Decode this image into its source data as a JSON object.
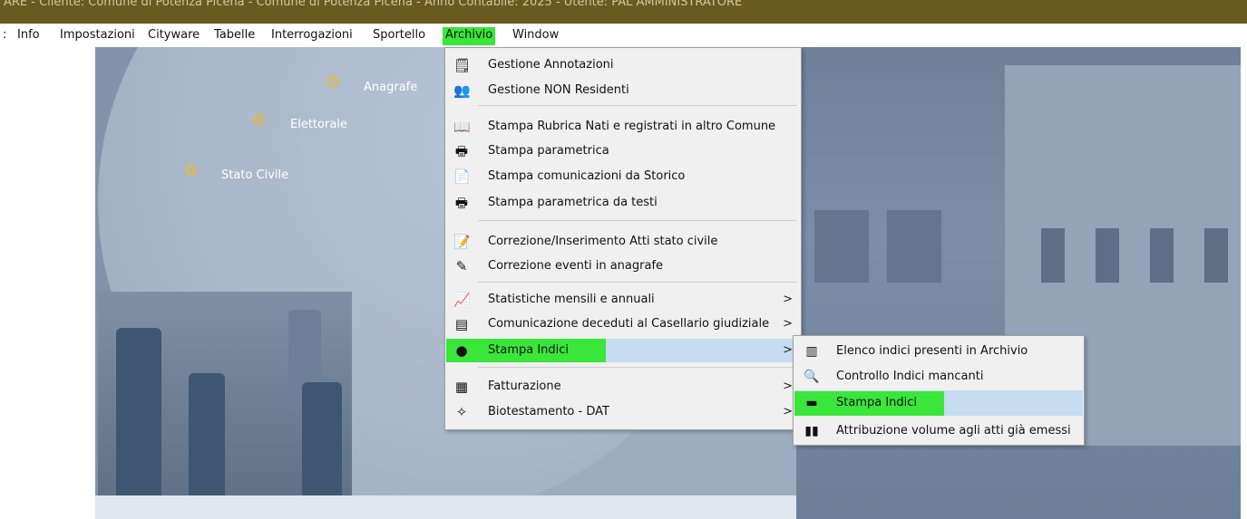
{
  "title_bar": {
    "text": "ARE - Cliente: Comune di Potenza Picena - Comune di Potenza Picena - Anno Contabile: 2025 - Utente: PAL AMMINISTRATORE"
  },
  "menu_bar": {
    "leading": ":",
    "items": [
      {
        "label": "Info"
      },
      {
        "label": "Impostazioni"
      },
      {
        "label": "Cityware"
      },
      {
        "label": "Tabelle"
      },
      {
        "label": "Interrogazioni"
      },
      {
        "label": "Sportello"
      },
      {
        "label": "Archivio",
        "active": true
      },
      {
        "label": "Window"
      }
    ]
  },
  "background": {
    "labels": [
      "Anagrafe",
      "Elettorale",
      "Stato Civile"
    ]
  },
  "archivio_menu": {
    "items": [
      {
        "label": "Gestione Annotazioni",
        "icon": "annotation-icon"
      },
      {
        "label": "Gestione NON Residenti",
        "icon": "people-icon"
      },
      {
        "label": "Stampa Rubrica Nati e registrati in altro Comune",
        "icon": "book-icon"
      },
      {
        "label": "Stampa parametrica",
        "icon": "printer-icon"
      },
      {
        "label": "Stampa comunicazioni da Storico",
        "icon": "document-icon"
      },
      {
        "label": "Stampa parametrica da testi",
        "icon": "printer-icon"
      },
      {
        "label": "Correzione/Inserimento Atti stato civile",
        "icon": "edit-form-icon"
      },
      {
        "label": "Correzione eventi in anagrafe",
        "icon": "edit-pencil-icon"
      },
      {
        "label": "Statistiche mensili e annuali",
        "icon": "chart-icon",
        "submenu": true
      },
      {
        "label": "Comunicazione deceduti al Casellario giudiziale",
        "icon": "card-icon",
        "submenu": true
      },
      {
        "label": "Stampa Indici",
        "icon": "index-icon",
        "submenu": true,
        "selected": true
      },
      {
        "label": "Fatturazione",
        "icon": "calculator-icon",
        "submenu": true
      },
      {
        "label": "Biotestamento - DAT",
        "icon": "dat-icon",
        "submenu": true
      }
    ],
    "arrow": ">"
  },
  "stampa_indici_submenu": {
    "items": [
      {
        "label": "Elenco indici presenti in Archivio",
        "icon": "list-icon"
      },
      {
        "label": "Controllo Indici mancanti",
        "icon": "search-doc-icon"
      },
      {
        "label": "Stampa Indici",
        "icon": "print-green-icon",
        "selected": true
      },
      {
        "label": "Attribuzione volume agli atti già emessi",
        "icon": "volumes-icon"
      }
    ]
  },
  "colors": {
    "title_bar": "#6b5a1f",
    "highlight_green": "#39e639",
    "menu_hover": "#c6dcf0"
  }
}
